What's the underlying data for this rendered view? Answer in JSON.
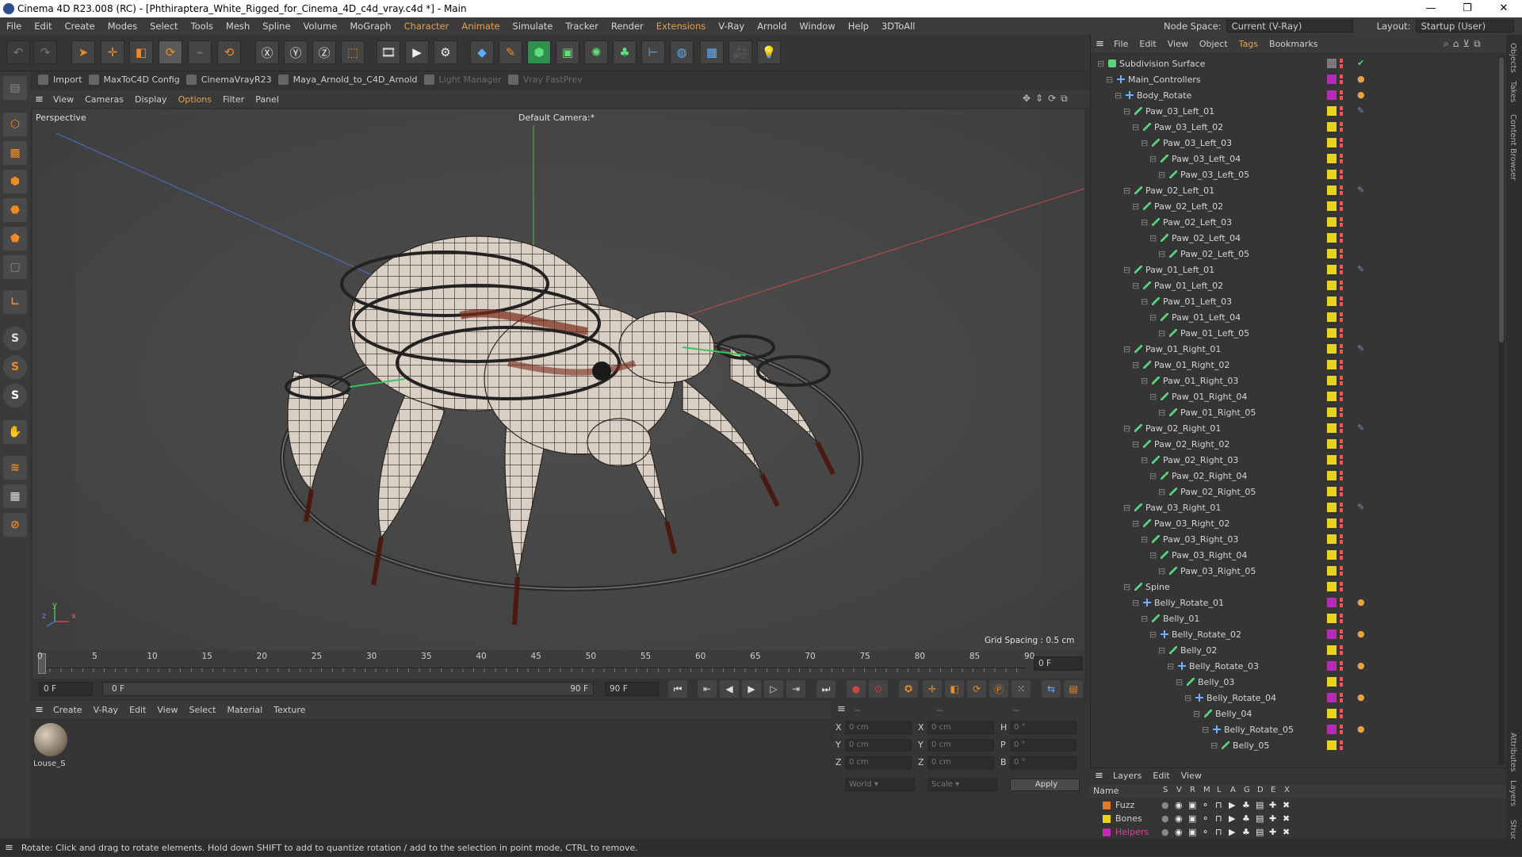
{
  "window": {
    "title": "Cinema 4D R23.008 (RC) - [Phthiraptera_White_Rigged_for_Cinema_4D_c4d_vray.c4d *] - Main",
    "min": "—",
    "max": "❐",
    "close": "✕"
  },
  "menu": {
    "items": [
      "File",
      "Edit",
      "Create",
      "Modes",
      "Select",
      "Tools",
      "Mesh",
      "Spline",
      "Volume",
      "MoGraph",
      "Character",
      "Animate",
      "Simulate",
      "Tracker",
      "Render",
      "Extensions",
      "V-Ray",
      "Arnold",
      "Window",
      "Help",
      "3DToAll"
    ],
    "highlighted": [
      "Character",
      "Animate",
      "Extensions"
    ],
    "node_space_label": "Node Space:",
    "node_space_value": "Current (V-Ray)",
    "layout_label": "Layout:",
    "layout_value": "Startup (User)"
  },
  "plugins": [
    {
      "label": "Import",
      "dim": false
    },
    {
      "label": "MaxToC4D Config",
      "dim": false
    },
    {
      "label": "CinemaVrayR23",
      "dim": false
    },
    {
      "label": "Maya_Arnold_to_C4D_Arnold",
      "dim": false
    },
    {
      "label": "Light Manager",
      "dim": true
    },
    {
      "label": "Vray FastPrev",
      "dim": true
    }
  ],
  "viewport": {
    "menu": [
      "View",
      "Cameras",
      "Display",
      "Options",
      "Filter",
      "Panel"
    ],
    "highlighted": [
      "Options"
    ],
    "projection": "Perspective",
    "camera": "Default Camera",
    "camera_suffix": ":*",
    "grid_spacing": "Grid Spacing : 0.5 cm",
    "axis_y": "y",
    "axis_z": "z",
    "axis_x": "x"
  },
  "timeline": {
    "ticks": [
      "0",
      "5",
      "10",
      "15",
      "20",
      "25",
      "30",
      "35",
      "40",
      "45",
      "50",
      "55",
      "60",
      "65",
      "70",
      "75",
      "80",
      "85",
      "90"
    ],
    "current_frame_label": "0 F",
    "start_field": "0 F",
    "range_start": "0 F",
    "range_end": "90 F",
    "end_field": "90 F"
  },
  "materials": {
    "menu": [
      "Create",
      "V-Ray",
      "Edit",
      "View",
      "Select",
      "Material",
      "Texture"
    ],
    "items": [
      {
        "name": "Louse_S"
      }
    ]
  },
  "attributes": {
    "header": "--",
    "header2": "--",
    "header3": "--",
    "rows": [
      {
        "l1": "X",
        "v1": "0 cm",
        "l2": "X",
        "v2": "0 cm",
        "l3": "H",
        "v3": "0 °"
      },
      {
        "l1": "Y",
        "v1": "0 cm",
        "l2": "Y",
        "v2": "0 cm",
        "l3": "P",
        "v3": "0 °"
      },
      {
        "l1": "Z",
        "v1": "0 cm",
        "l2": "Z",
        "v2": "0 cm",
        "l3": "B",
        "v3": "0 °"
      }
    ],
    "coord_mode": "World",
    "scale_mode": "Scale",
    "apply": "Apply"
  },
  "status": "Rotate: Click and drag to rotate elements. Hold down SHIFT to add to quantize rotation / add to the selection in point mode, CTRL to remove.",
  "objects": {
    "menu": [
      "File",
      "Edit",
      "View",
      "Object",
      "Tags",
      "Bookmarks"
    ],
    "highlighted": [
      "Tags"
    ],
    "tree": [
      {
        "name": "Subdivision Surface",
        "depth": 0,
        "color": "#7a7a7a",
        "kind": "subd",
        "tag": "✔"
      },
      {
        "name": "Main_Controllers",
        "depth": 1,
        "color": "#b52bb5",
        "kind": "null",
        "tag": "●"
      },
      {
        "name": "Body_Rotate",
        "depth": 2,
        "color": "#b52bb5",
        "kind": "null",
        "tag": "●"
      },
      {
        "name": "Paw_03_Left_01",
        "depth": 3,
        "color": "#e8d21e",
        "kind": "bone",
        "tag": "✎"
      },
      {
        "name": "Paw_03_Left_02",
        "depth": 4,
        "color": "#e8d21e",
        "kind": "bone",
        "tag": ""
      },
      {
        "name": "Paw_03_Left_03",
        "depth": 5,
        "color": "#e8d21e",
        "kind": "bone",
        "tag": ""
      },
      {
        "name": "Paw_03_Left_04",
        "depth": 6,
        "color": "#e8d21e",
        "kind": "bone",
        "tag": ""
      },
      {
        "name": "Paw_03_Left_05",
        "depth": 7,
        "color": "#e8d21e",
        "kind": "bone",
        "tag": ""
      },
      {
        "name": "Paw_02_Left_01",
        "depth": 3,
        "color": "#e8d21e",
        "kind": "bone",
        "tag": "✎"
      },
      {
        "name": "Paw_02_Left_02",
        "depth": 4,
        "color": "#e8d21e",
        "kind": "bone",
        "tag": ""
      },
      {
        "name": "Paw_02_Left_03",
        "depth": 5,
        "color": "#e8d21e",
        "kind": "bone",
        "tag": ""
      },
      {
        "name": "Paw_02_Left_04",
        "depth": 6,
        "color": "#e8d21e",
        "kind": "bone",
        "tag": ""
      },
      {
        "name": "Paw_02_Left_05",
        "depth": 7,
        "color": "#e8d21e",
        "kind": "bone",
        "tag": ""
      },
      {
        "name": "Paw_01_Left_01",
        "depth": 3,
        "color": "#e8d21e",
        "kind": "bone",
        "tag": "✎"
      },
      {
        "name": "Paw_01_Left_02",
        "depth": 4,
        "color": "#e8d21e",
        "kind": "bone",
        "tag": ""
      },
      {
        "name": "Paw_01_Left_03",
        "depth": 5,
        "color": "#e8d21e",
        "kind": "bone",
        "tag": ""
      },
      {
        "name": "Paw_01_Left_04",
        "depth": 6,
        "color": "#e8d21e",
        "kind": "bone",
        "tag": ""
      },
      {
        "name": "Paw_01_Left_05",
        "depth": 7,
        "color": "#e8d21e",
        "kind": "bone",
        "tag": ""
      },
      {
        "name": "Paw_01_Right_01",
        "depth": 3,
        "color": "#e8d21e",
        "kind": "bone",
        "tag": "✎"
      },
      {
        "name": "Paw_01_Right_02",
        "depth": 4,
        "color": "#e8d21e",
        "kind": "bone",
        "tag": ""
      },
      {
        "name": "Paw_01_Right_03",
        "depth": 5,
        "color": "#e8d21e",
        "kind": "bone",
        "tag": ""
      },
      {
        "name": "Paw_01_Right_04",
        "depth": 6,
        "color": "#e8d21e",
        "kind": "bone",
        "tag": ""
      },
      {
        "name": "Paw_01_Right_05",
        "depth": 7,
        "color": "#e8d21e",
        "kind": "bone",
        "tag": ""
      },
      {
        "name": "Paw_02_Right_01",
        "depth": 3,
        "color": "#e8d21e",
        "kind": "bone",
        "tag": "✎"
      },
      {
        "name": "Paw_02_Right_02",
        "depth": 4,
        "color": "#e8d21e",
        "kind": "bone",
        "tag": ""
      },
      {
        "name": "Paw_02_Right_03",
        "depth": 5,
        "color": "#e8d21e",
        "kind": "bone",
        "tag": ""
      },
      {
        "name": "Paw_02_Right_04",
        "depth": 6,
        "color": "#e8d21e",
        "kind": "bone",
        "tag": ""
      },
      {
        "name": "Paw_02_Right_05",
        "depth": 7,
        "color": "#e8d21e",
        "kind": "bone",
        "tag": ""
      },
      {
        "name": "Paw_03_Right_01",
        "depth": 3,
        "color": "#e8d21e",
        "kind": "bone",
        "tag": "✎"
      },
      {
        "name": "Paw_03_Right_02",
        "depth": 4,
        "color": "#e8d21e",
        "kind": "bone",
        "tag": ""
      },
      {
        "name": "Paw_03_Right_03",
        "depth": 5,
        "color": "#e8d21e",
        "kind": "bone",
        "tag": ""
      },
      {
        "name": "Paw_03_Right_04",
        "depth": 6,
        "color": "#e8d21e",
        "kind": "bone",
        "tag": ""
      },
      {
        "name": "Paw_03_Right_05",
        "depth": 7,
        "color": "#e8d21e",
        "kind": "bone",
        "tag": ""
      },
      {
        "name": "Spine",
        "depth": 3,
        "color": "#e8d21e",
        "kind": "bone",
        "tag": ""
      },
      {
        "name": "Belly_Rotate_01",
        "depth": 4,
        "color": "#b52bb5",
        "kind": "null",
        "tag": "●"
      },
      {
        "name": "Belly_01",
        "depth": 5,
        "color": "#e8d21e",
        "kind": "bone",
        "tag": ""
      },
      {
        "name": "Belly_Rotate_02",
        "depth": 6,
        "color": "#b52bb5",
        "kind": "null",
        "tag": "●"
      },
      {
        "name": "Belly_02",
        "depth": 7,
        "color": "#e8d21e",
        "kind": "bone",
        "tag": ""
      },
      {
        "name": "Belly_Rotate_03",
        "depth": 8,
        "color": "#b52bb5",
        "kind": "null",
        "tag": "●"
      },
      {
        "name": "Belly_03",
        "depth": 9,
        "color": "#e8d21e",
        "kind": "bone",
        "tag": ""
      },
      {
        "name": "Belly_Rotate_04",
        "depth": 10,
        "color": "#b52bb5",
        "kind": "null",
        "tag": "●"
      },
      {
        "name": "Belly_04",
        "depth": 11,
        "color": "#e8d21e",
        "kind": "bone",
        "tag": ""
      },
      {
        "name": "Belly_Rotate_05",
        "depth": 12,
        "color": "#b52bb5",
        "kind": "null",
        "tag": "●"
      },
      {
        "name": "Belly_05",
        "depth": 13,
        "color": "#e8d21e",
        "kind": "bone",
        "tag": ""
      }
    ]
  },
  "layers": {
    "menu": [
      "Layers",
      "Edit",
      "View"
    ],
    "header_name": "Name",
    "header_flags": [
      "S",
      "V",
      "R",
      "M",
      "L",
      "A",
      "G",
      "D",
      "E",
      "X"
    ],
    "items": [
      {
        "name": "Fuzz",
        "color": "#e07a2a"
      },
      {
        "name": "Bones",
        "color": "#e8d21e"
      },
      {
        "name": "Helpers",
        "color": "#c42bb5"
      }
    ]
  },
  "side_tabs": [
    "Objects",
    "Takes",
    "Content Browser",
    "Attributes",
    "Layers",
    "Structure"
  ]
}
